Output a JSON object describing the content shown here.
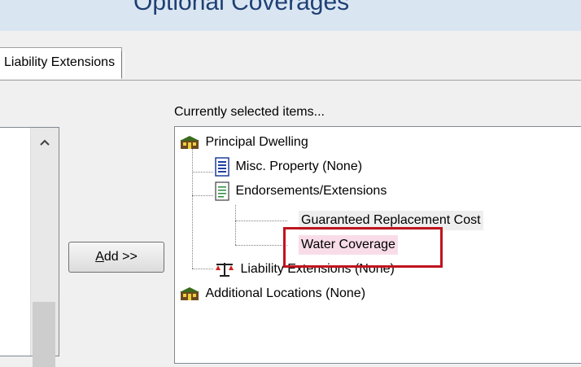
{
  "window": {
    "title": "Optional Coverages"
  },
  "tabs": [
    {
      "label": "Liability Extensions"
    }
  ],
  "actions": {
    "add_label_prefix": "A",
    "add_label_rest": "dd >>"
  },
  "selected_panel": {
    "label": "Currently selected items...",
    "tree": {
      "principal_dwelling": "Principal Dwelling",
      "misc_property": "Misc. Property (None)",
      "endorsements": "Endorsements/Extensions",
      "guaranteed_replacement": "Guaranteed Replacement Cost",
      "water_coverage": "Water Coverage",
      "liability_extensions": "Liability Extensions (None)",
      "additional_locations": "Additional Locations (None)"
    }
  },
  "colors": {
    "highlight_border": "#c0141e",
    "selected_pink": "#f8dde8",
    "title_text": "#1f3f73"
  }
}
